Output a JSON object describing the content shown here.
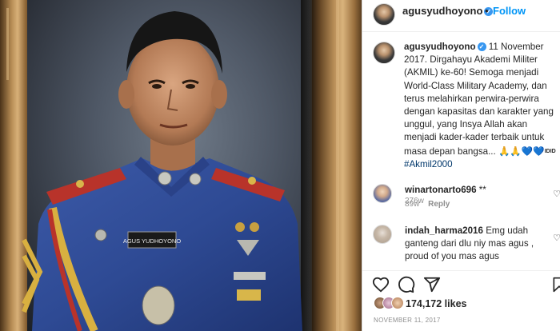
{
  "post": {
    "author": "agusyudhoyono",
    "follow_label": "Follow",
    "separator": "•",
    "caption_date": "11 November 2017.",
    "caption_body": "Dirgahayu Akademi Militer (AKMIL) ke-60! Semoga menjadi World-Class Military Academy, dan terus melahirkan perwira-perwira dengan kapasitas dan karakter yang unggul, yang Insya Allah akan menjadi kader-kader terbaik untuk masa depan bangsa...",
    "caption_emoji": "🙏🙏💙💙",
    "caption_idid": "IDID",
    "hashtag": "#Akmil2000",
    "time_ago": "276w"
  },
  "photo": {
    "name_tag": "AGUS YUDHOYONO"
  },
  "comments": [
    {
      "user": "winartonarto696",
      "text": "**",
      "time": "89w",
      "reply_label": "Reply"
    },
    {
      "user": "indah_harma2016",
      "text": "Emg udah ganteng dari dlu niy mas agus , proud of you mas agus"
    }
  ],
  "footer": {
    "likes_count": "174,172",
    "likes_word": "likes",
    "date": "NOVEMBER 11, 2017"
  },
  "icons": [
    "verified-badge-icon",
    "heart-icon",
    "comment-icon",
    "share-icon",
    "bookmark-icon",
    "heart-small-icon"
  ],
  "colors": {
    "accent": "#0095f6",
    "verified": "#3897f0",
    "hashtag": "#00376b",
    "muted": "#8e8e8e"
  }
}
